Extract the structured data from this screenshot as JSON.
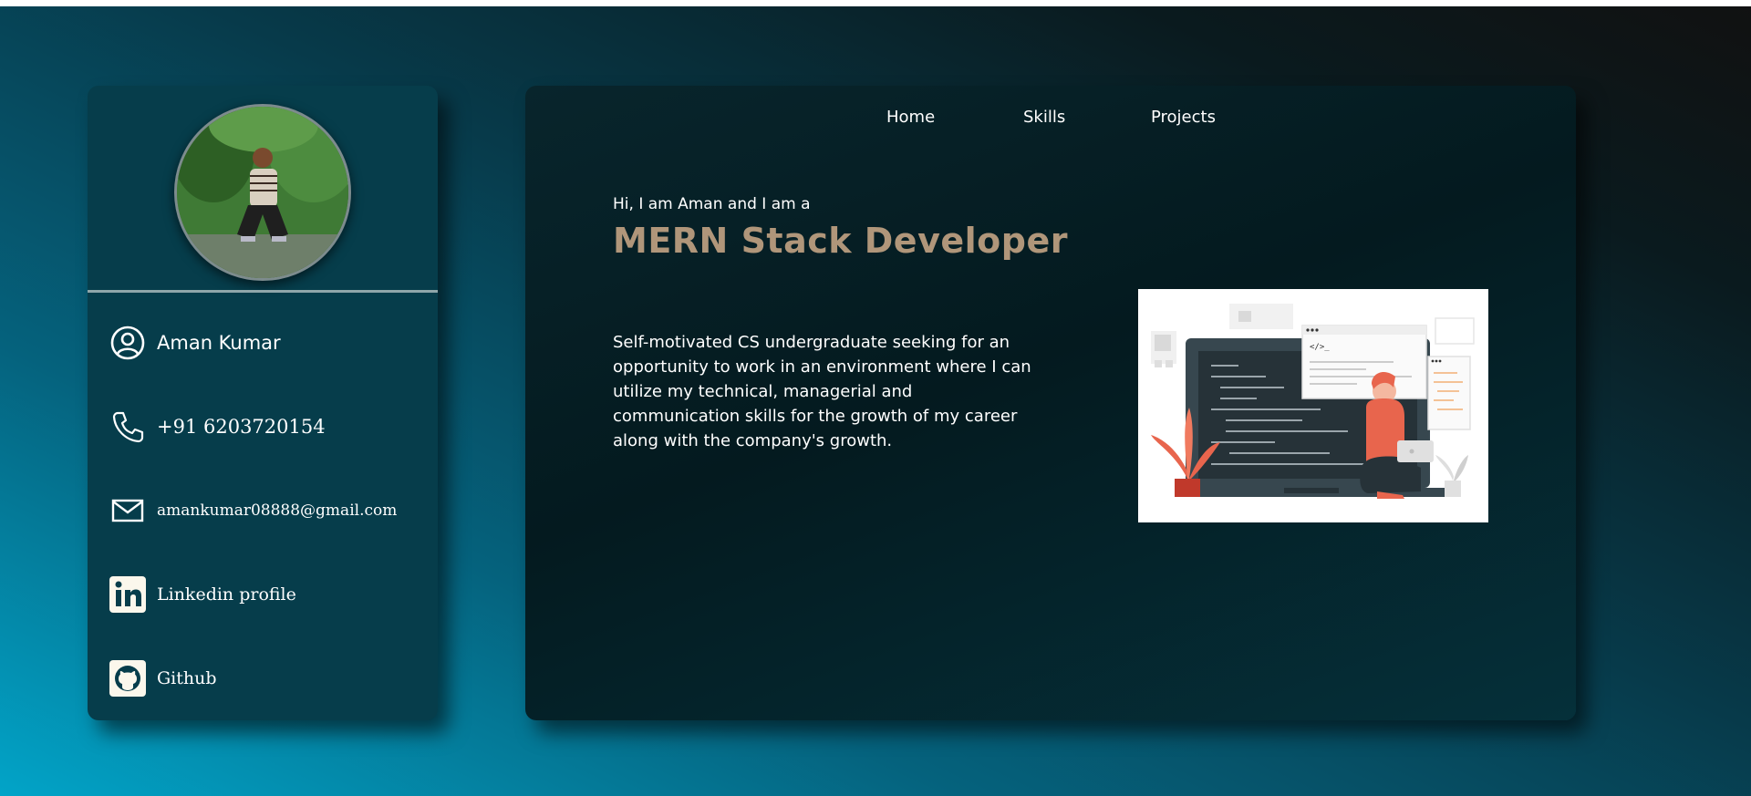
{
  "profile": {
    "name": "Aman Kumar",
    "phone": "+91 6203720154",
    "email": "amankumar08888@gmail.com",
    "linkedin_label": "Linkedin profile",
    "github_label": "Github"
  },
  "nav": {
    "home": "Home",
    "skills": "Skills",
    "projects": "Projects"
  },
  "hero": {
    "greeting": "Hi, I am Aman and I am a",
    "role": "MERN Stack Developer",
    "about": "Self-motivated CS undergraduate seeking for an opportunity to work in an environment where I can utilize my technical, managerial and communication skills for the growth of my career along with the company's growth."
  },
  "icons": {
    "user": "user-circle-icon",
    "phone": "phone-icon",
    "email": "mail-icon",
    "linkedin": "linkedin-icon",
    "github": "github-icon"
  },
  "colors": {
    "card_bg": "#063d4b",
    "accent_role": "#b0967a",
    "text": "#ffffff"
  }
}
